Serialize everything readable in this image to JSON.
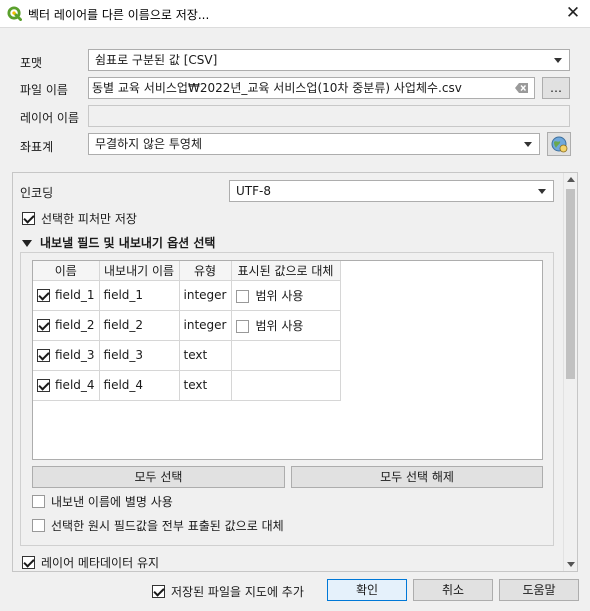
{
  "window": {
    "title": "벡터 레이어를 다른 이름으로 저장..."
  },
  "form": {
    "format_label": "포맷",
    "format_value": "쉼표로 구분된 값 [CSV]",
    "filename_label": "파일 이름",
    "filename_value": "동별 교육 서비스업₩2022년_교육 서비스업(10차 중분류) 사업체수.csv",
    "browse_label": "…",
    "layername_label": "레이어 이름",
    "layername_value": "",
    "crs_label": "좌표계",
    "crs_value": "무결하지 않은 투영체"
  },
  "panel": {
    "encoding_label": "인코딩",
    "encoding_value": "UTF-8",
    "selected_only_label": "선택한 피처만 저장",
    "selected_only_checked": true,
    "section_title": "내보낼 필드 및 내보내기 옵션 선택",
    "table": {
      "headers": [
        "이름",
        "내보내기 이름",
        "유형",
        "표시된 값으로 대체"
      ],
      "rows": [
        {
          "name": "field_1",
          "export_name": "field_1",
          "type": "integer",
          "replace_label": "범위 사용",
          "checked": true,
          "has_replace": true
        },
        {
          "name": "field_2",
          "export_name": "field_2",
          "type": "integer",
          "replace_label": "범위 사용",
          "checked": true,
          "has_replace": true
        },
        {
          "name": "field_3",
          "export_name": "field_3",
          "type": "text",
          "replace_label": "",
          "checked": true,
          "has_replace": false
        },
        {
          "name": "field_4",
          "export_name": "field_4",
          "type": "text",
          "replace_label": "",
          "checked": true,
          "has_replace": false
        }
      ]
    },
    "select_all_label": "모두 선택",
    "deselect_all_label": "모두 선택 해제",
    "use_alias_label": "내보낸 이름에 별명 사용",
    "replace_raw_label": "선택한 원시 필드값을 전부 표출된 값으로 대체",
    "keep_metadata_label": "레이어 메타데이터 유지",
    "keep_metadata_checked": true
  },
  "footer": {
    "add_to_map_label": "저장된 파일을 지도에 추가",
    "add_to_map_checked": true,
    "ok_label": "확인",
    "cancel_label": "취소",
    "help_label": "도움말"
  },
  "colors": {
    "accent": "#0078d7",
    "qgis_green": "#5aa02c"
  }
}
